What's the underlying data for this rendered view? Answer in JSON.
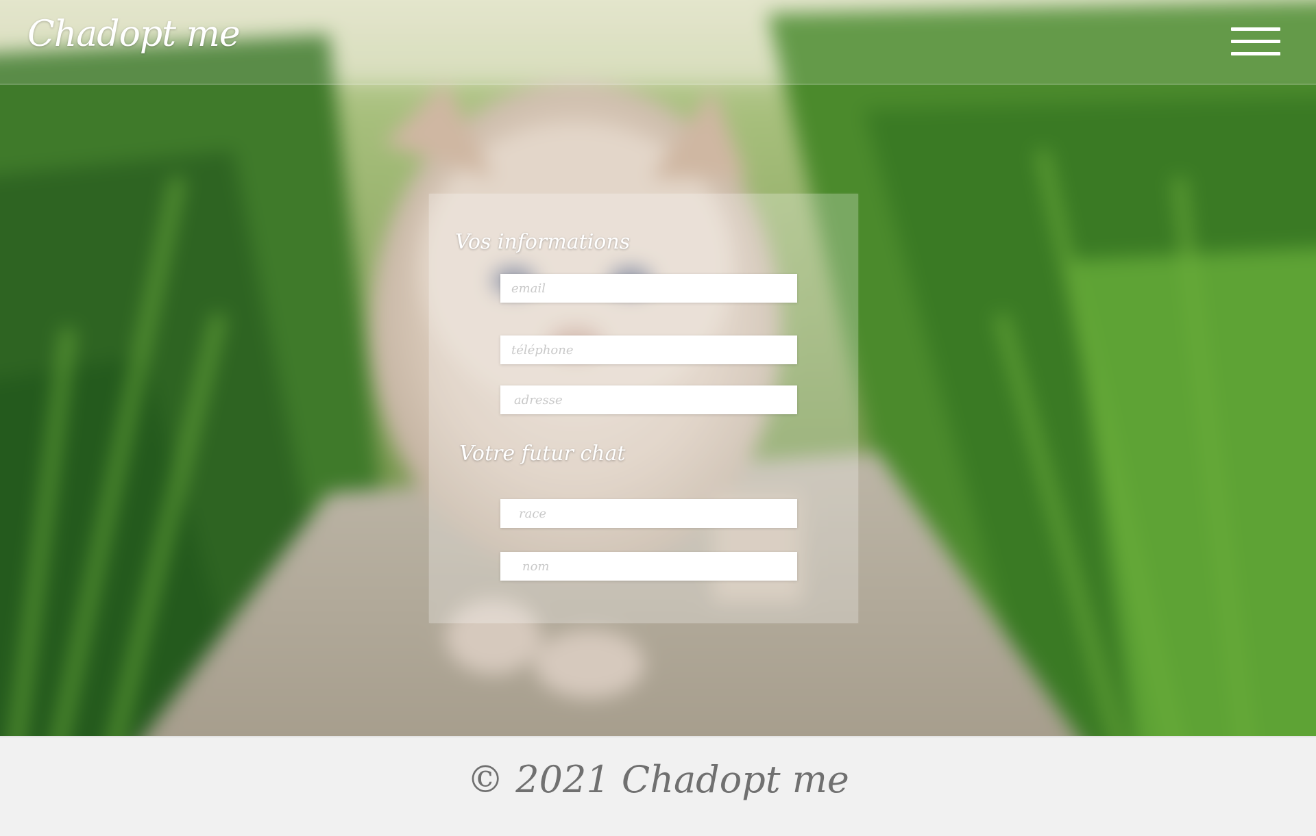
{
  "header": {
    "brand": "Chadopt me",
    "menu_icon": "hamburger-menu-icon"
  },
  "form": {
    "section_info_title": "Vos informations",
    "email_placeholder": "email",
    "phone_placeholder": "téléphone",
    "address_placeholder": "adresse",
    "section_cat_title": "Votre futur chat",
    "breed_placeholder": "race",
    "name_placeholder": "nom"
  },
  "footer": {
    "text": "© 2021 Chadopt me"
  },
  "colors": {
    "panel": "#ffffff",
    "footer_bg": "#f1f1f1",
    "footer_text": "#707070"
  }
}
